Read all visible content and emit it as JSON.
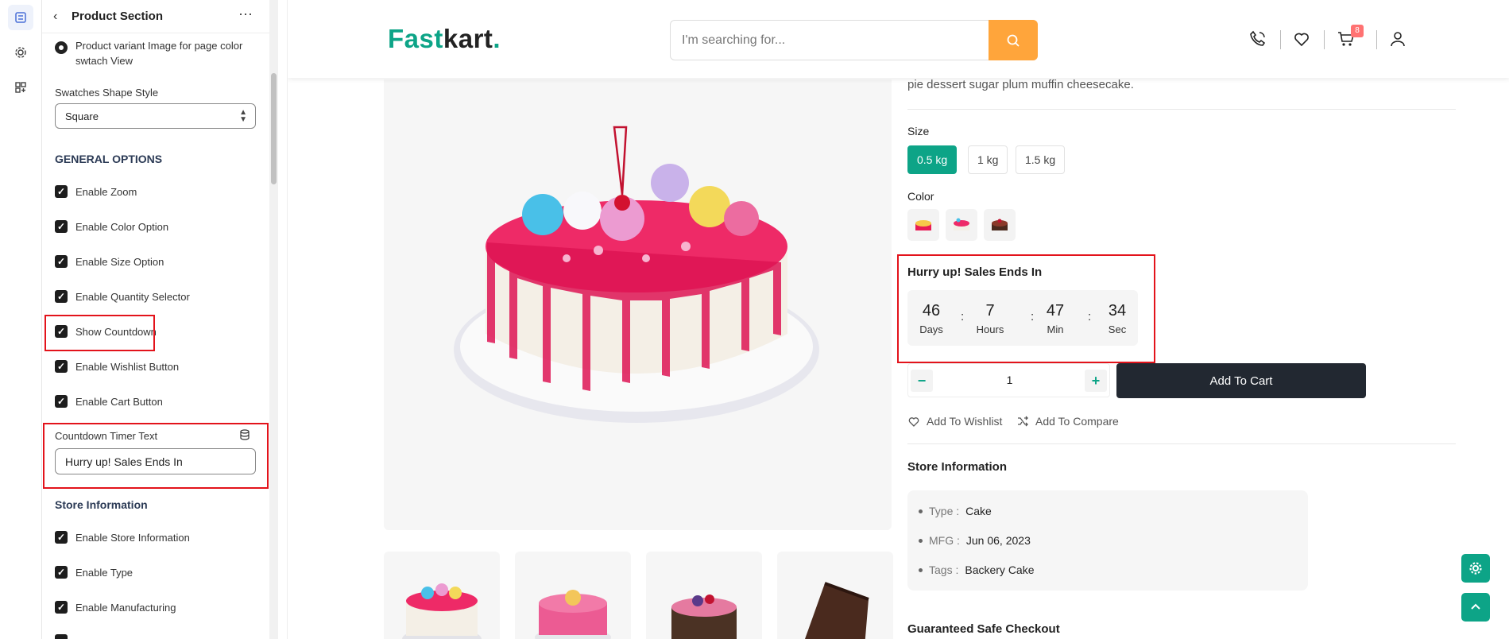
{
  "sidebar": {
    "title": "Product Section",
    "variant_option": "Product variant Image for page color swtach View",
    "swatches_label": "Swatches Shape Style",
    "swatches_value": "Square",
    "general_title": "GENERAL OPTIONS",
    "options": [
      {
        "label": "Enable Zoom",
        "checked": true
      },
      {
        "label": "Enable Color Option",
        "checked": true
      },
      {
        "label": "Enable Size Option",
        "checked": true
      },
      {
        "label": "Enable Quantity Selector",
        "checked": true
      },
      {
        "label": "Show Countdown",
        "checked": true
      },
      {
        "label": "Enable Wishlist Button",
        "checked": true
      },
      {
        "label": "Enable Cart Button",
        "checked": true
      }
    ],
    "countdown_label": "Countdown Timer Text",
    "countdown_value": "Hurry up! Sales Ends In",
    "store_title": "Store Information",
    "store_options": [
      {
        "label": "Enable Store Information",
        "checked": true
      },
      {
        "label": "Enable Type",
        "checked": true
      },
      {
        "label": "Enable Manufacturing",
        "checked": true
      }
    ]
  },
  "header": {
    "logo_a": "Fast",
    "logo_b": "kart",
    "logo_dot": ".",
    "search_placeholder": "I'm searching for...",
    "cart_count": "8"
  },
  "product": {
    "desc_tail": "pie dessert sugar plum muffin cheesecake.",
    "size_label": "Size",
    "sizes": [
      "0.5 kg",
      "1 kg",
      "1.5 kg"
    ],
    "selected_size": "0.5 kg",
    "color_label": "Color",
    "countdown_title": "Hurry up! Sales Ends In",
    "countdown": [
      {
        "num": "46",
        "unit": "Days"
      },
      {
        "num": "7",
        "unit": "Hours"
      },
      {
        "num": "47",
        "unit": "Min"
      },
      {
        "num": "34",
        "unit": "Sec"
      }
    ],
    "qty_minus": "−",
    "qty_plus": "+",
    "quantity": "1",
    "add_to_cart": "Add To Cart",
    "wishlist": "Add To Wishlist",
    "compare": "Add To Compare",
    "store_title": "Store Information",
    "store_info": [
      {
        "key": "Type :",
        "value": "Cake"
      },
      {
        "key": "MFG :",
        "value": "Jun 06, 2023"
      },
      {
        "key": "Tags :",
        "value": "Backery Cake"
      }
    ],
    "safe_checkout": "Guaranteed Safe Checkout"
  },
  "colors": {
    "brand": "#0da487",
    "search_btn": "#ffa53b",
    "highlight": "#e3131b",
    "cart_btn": "#222831"
  },
  "icons": [
    "back-icon",
    "more-icon",
    "search-icon",
    "phone-icon",
    "heart-icon",
    "cart-icon",
    "user-icon",
    "database-icon",
    "gear-icon",
    "arrow-up-icon"
  ]
}
